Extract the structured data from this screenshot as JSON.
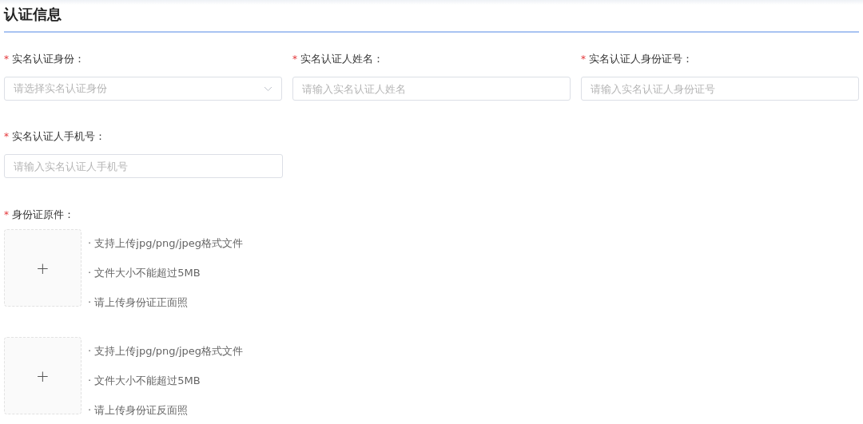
{
  "section": {
    "title": "认证信息"
  },
  "rows": [
    [
      {
        "kind": "select",
        "mark": "*",
        "label": "实名认证身份：",
        "placeholder": "请选择实名认证身份"
      },
      {
        "kind": "input",
        "mark": "*",
        "label": "实名认证人姓名：",
        "placeholder": "请输入实名认证人姓名"
      },
      {
        "kind": "input",
        "mark": "*",
        "label": "实名认证人身份证号：",
        "placeholder": "请输入实名认证人身份证号"
      }
    ],
    [
      {
        "kind": "input",
        "mark": "*",
        "label": "实名认证人手机号：",
        "placeholder": "请输入实名认证人手机号"
      }
    ]
  ],
  "upload": {
    "mark": "*",
    "label": "身份证原件：",
    "slots": [
      {
        "plus": "+",
        "hints": [
          "· 支持上传jpg/png/jpeg格式文件",
          "· 文件大小不能超过5MB",
          "· 请上传身份证正面照"
        ]
      },
      {
        "plus": "+",
        "hints": [
          "· 支持上传jpg/png/jpeg格式文件",
          "· 文件大小不能超过5MB",
          "· 请上传身份证反面照"
        ]
      }
    ]
  }
}
